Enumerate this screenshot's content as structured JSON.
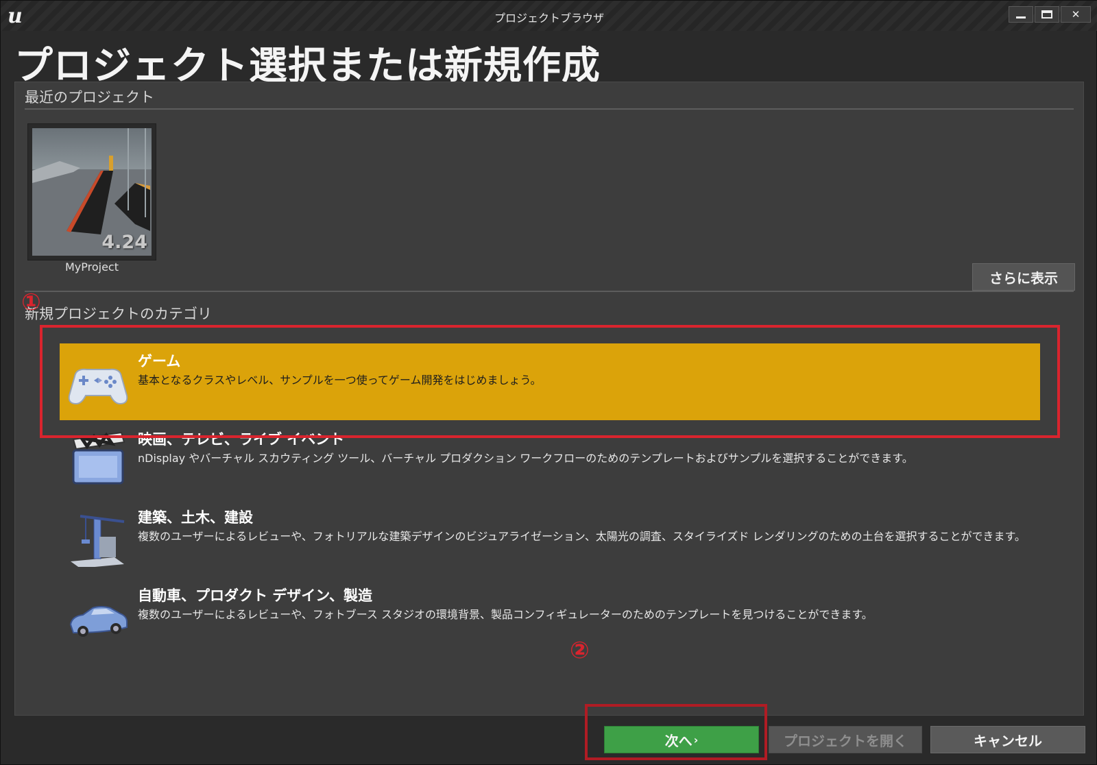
{
  "window": {
    "title": "プロジェクトブラウザ",
    "controls": {
      "minimize": "",
      "maximize": "",
      "close": "✕"
    }
  },
  "header": {
    "title": "プロジェクト選択または新規作成"
  },
  "recent": {
    "label": "最近のプロジェクト",
    "projects": [
      {
        "name": "MyProject",
        "version": "4.24"
      }
    ],
    "more_label": "さらに表示"
  },
  "categories": {
    "label": "新規プロジェクトのカテゴリ",
    "items": [
      {
        "title": "ゲーム",
        "description": "基本となるクラスやレベル、サンプルを一つ使ってゲーム開発をはじめましょう。",
        "icon": "gamepad-icon",
        "selected": true
      },
      {
        "title": "映画、テレビ、ライブ イベント",
        "description": "nDisplay やバーチャル スカウティング ツール、バーチャル プロダクション ワークフローのためのテンプレートおよびサンプルを選択することができます。",
        "icon": "clapperboard-icon",
        "selected": false
      },
      {
        "title": "建築、土木、建設",
        "description": "複数のユーザーによるレビューや、フォトリアルな建築デザインのビジュアライゼーション、太陽光の調査、スタイライズド レンダリングのための土台を選択することができます。",
        "icon": "crane-icon",
        "selected": false
      },
      {
        "title": "自動車、プロダクト デザイン、製造",
        "description": "複数のユーザーによるレビューや、フォトブース スタジオの環境背景、製品コンフィギュレーターのためのテンプレートを見つけることができます。",
        "icon": "car-icon",
        "selected": false
      }
    ]
  },
  "annotations": {
    "step1": "①",
    "step2": "②"
  },
  "footer": {
    "next_label": "次へ",
    "open_label": "プロジェクトを開く",
    "cancel_label": "キャンセル"
  },
  "colors": {
    "selected": "#dba30a",
    "next": "#3ea047",
    "annotation": "#d9242e"
  }
}
